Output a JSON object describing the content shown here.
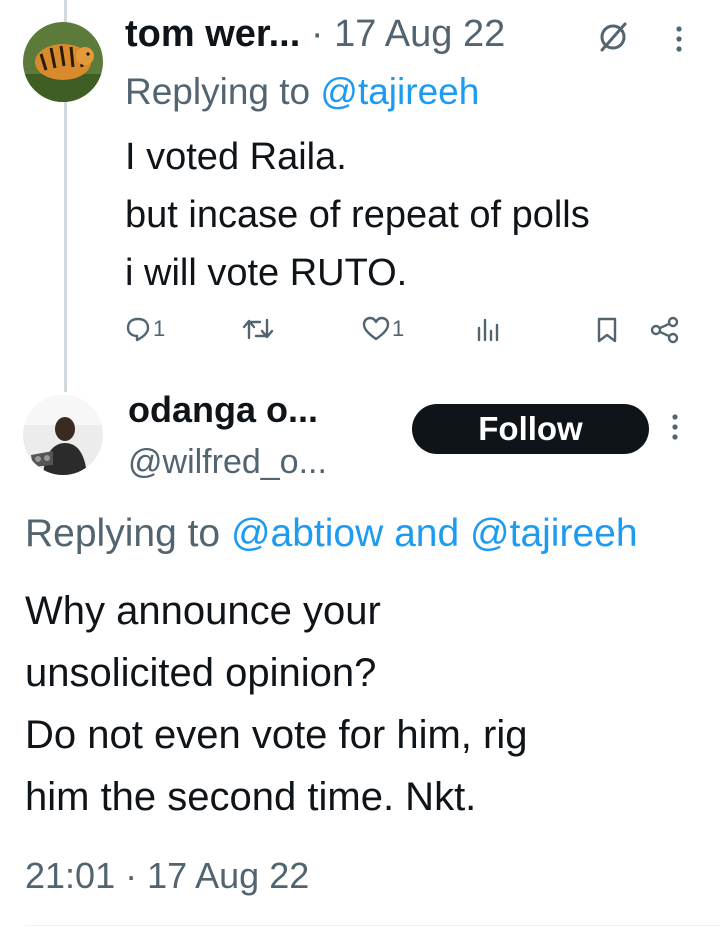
{
  "tweet1": {
    "display_name": "tom wer...",
    "separator": " · ",
    "date": "17 Aug 22",
    "replying_prefix": "Replying to ",
    "replying_handle": "@tajireeh",
    "body_lines": [
      "I voted Raila.",
      "but incase of repeat of polls",
      "i will vote RUTO."
    ],
    "reply_count": "1",
    "like_count": "1"
  },
  "tweet2": {
    "display_name": "odanga o...",
    "handle": "@wilfred_o...",
    "follow_label": "Follow",
    "replying_prefix": "Replying to ",
    "replying_handle_1": "@abtiow",
    "replying_and": " and ",
    "replying_handle_2": "@tajireeh",
    "body_lines": [
      "Why announce your",
      "unsolicited opinion?",
      "Do not even vote for him, rig",
      "him the second time. Nkt."
    ],
    "timestamp": "21:01 · 17 Aug 22"
  },
  "colors": {
    "muted": "#536471",
    "link": "#1d9bf0",
    "text": "#0f1419",
    "follow_bg": "#0f1419"
  },
  "icons": [
    "grok-icon",
    "more-icon",
    "reply-icon",
    "retweet-icon",
    "like-icon",
    "views-icon",
    "bookmark-icon",
    "share-icon"
  ]
}
